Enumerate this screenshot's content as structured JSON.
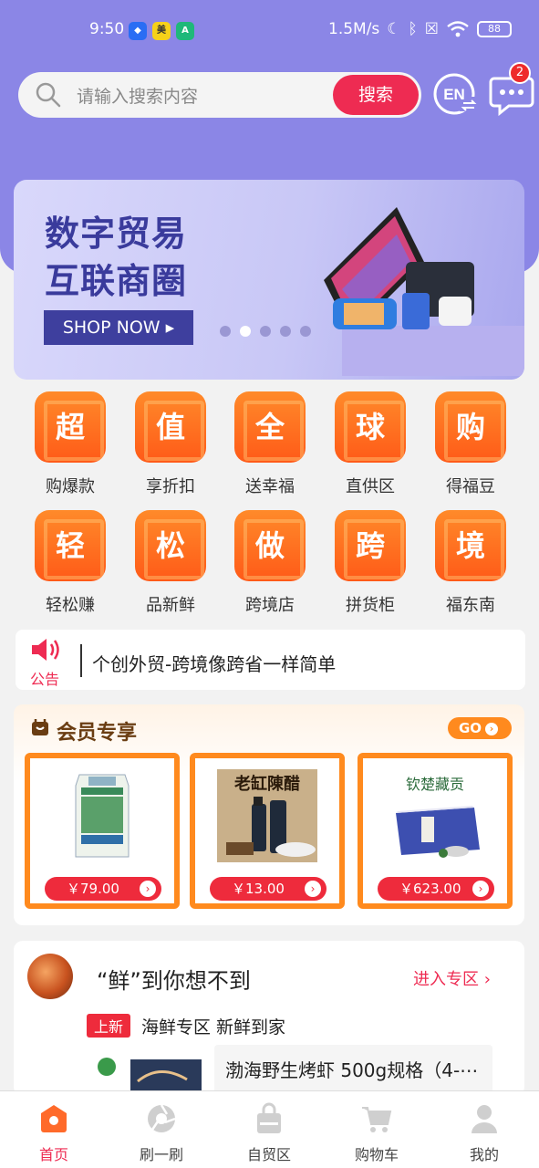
{
  "status_bar": {
    "time": "9:50",
    "net_speed": "1.5M/s",
    "battery": "88"
  },
  "search": {
    "placeholder": "请输入搜索内容",
    "button": "搜索"
  },
  "header": {
    "lang_label": "EN",
    "message_count": "2"
  },
  "banner": {
    "line1": "数字贸易",
    "line2": "互联商圈",
    "cta": "SHOP NOW ▸",
    "slides": 5,
    "active_slide": 2
  },
  "categories": [
    {
      "char": "超",
      "label": "购爆款"
    },
    {
      "char": "值",
      "label": "享折扣"
    },
    {
      "char": "全",
      "label": "送幸福"
    },
    {
      "char": "球",
      "label": "直供区"
    },
    {
      "char": "购",
      "label": "得福豆"
    },
    {
      "char": "轻",
      "label": "轻松赚"
    },
    {
      "char": "松",
      "label": "品新鲜"
    },
    {
      "char": "做",
      "label": "跨境店"
    },
    {
      "char": "跨",
      "label": "拼货柜"
    },
    {
      "char": "境",
      "label": "福东南"
    }
  ],
  "notice": {
    "label": "公告",
    "text": "个创外贸-跨境像跨省一样简单"
  },
  "member": {
    "title": "会员专享",
    "go": "GO",
    "products": [
      {
        "price": "￥79.00",
        "image": "rice-bag"
      },
      {
        "price": "￥13.00",
        "image": "vinegar-bottles",
        "image_text": "老缸陳醋"
      },
      {
        "price": "￥623.00",
        "image": "tea-gift-box",
        "image_text": "钦楚藏贡"
      }
    ]
  },
  "fresh": {
    "title": "“鲜”到你想不到",
    "link": "进入专区",
    "tag": "上新",
    "subtitle": "海鲜专区 新鲜到家",
    "item": "渤海野生烤虾 500g规格（4-⋯"
  },
  "tabbar": [
    {
      "label": "首页",
      "icon": "home-icon",
      "active": true
    },
    {
      "label": "刷一刷",
      "icon": "refresh-icon",
      "active": false
    },
    {
      "label": "自贸区",
      "icon": "bag-icon",
      "active": false
    },
    {
      "label": "购物车",
      "icon": "cart-icon",
      "active": false
    },
    {
      "label": "我的",
      "icon": "user-icon",
      "active": false
    }
  ],
  "colors": {
    "header": "#8b86e6",
    "accent": "#ee2b52",
    "tile": "#ff6a1e"
  }
}
